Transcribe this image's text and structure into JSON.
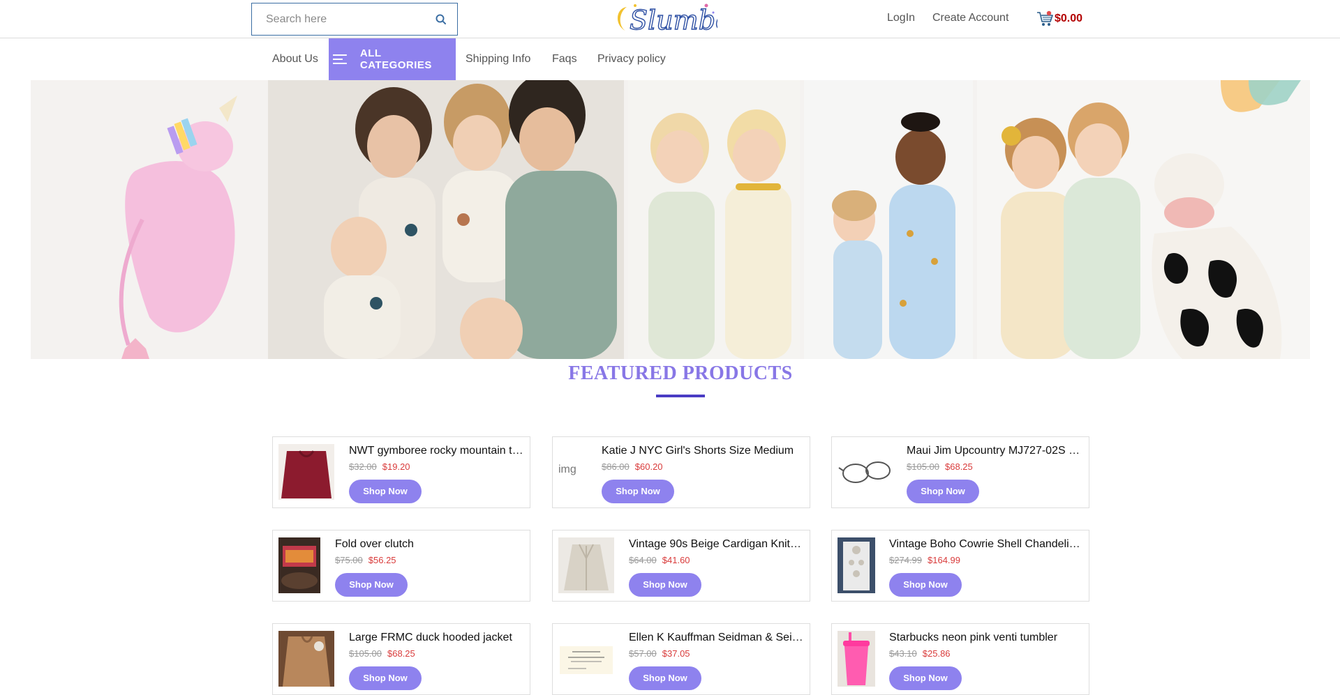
{
  "header": {
    "search_placeholder": "Search here",
    "login_label": "LogIn",
    "create_account_label": "Create Account",
    "cart_total": "$0.00"
  },
  "nav": {
    "about": "About Us",
    "all_categories": "ALL CATEGORIES",
    "shipping": "Shipping Info",
    "faqs": "Faqs",
    "privacy": "Privacy policy"
  },
  "featured": {
    "title": "FEATURED PRODUCTS",
    "shop_now_label": "Shop Now",
    "products": [
      {
        "name": "NWT gymboree rocky mountain t…",
        "old_price": "$32.00",
        "new_price": "$19.20",
        "image": "red-garment-thumb"
      },
      {
        "name": "Katie J NYC Girl's Shorts Size Medium",
        "old_price": "$86.00",
        "new_price": "$60.20",
        "image": "broken-image",
        "alt": "img"
      },
      {
        "name": "Maui Jim Upcountry MJ727-02S …",
        "old_price": "$105.00",
        "new_price": "$68.25",
        "image": "sunglasses-thumb"
      },
      {
        "name": "Fold over clutch",
        "old_price": "$75.00",
        "new_price": "$56.25",
        "image": "clutch-thumb"
      },
      {
        "name": "Vintage 90s Beige Cardigan Knit…",
        "old_price": "$64.00",
        "new_price": "$41.60",
        "image": "cardigan-thumb"
      },
      {
        "name": "Vintage Boho Cowrie Shell Chandeli…",
        "old_price": "$274.99",
        "new_price": "$164.99",
        "image": "chandelier-thumb"
      },
      {
        "name": "Large FRMC duck hooded jacket",
        "old_price": "$105.00",
        "new_price": "$68.25",
        "image": "jacket-thumb"
      },
      {
        "name": "Ellen K Kauffman Seidman & Sei…",
        "old_price": "$57.00",
        "new_price": "$37.05",
        "image": "document-thumb"
      },
      {
        "name": "Starbucks neon pink venti tumbler",
        "old_price": "$43.10",
        "new_price": "$25.86",
        "image": "tumbler-thumb"
      }
    ]
  },
  "colors": {
    "accent": "#8e82ee",
    "title_purple": "#8877e6",
    "underline": "#4a3cc4",
    "price_red": "#d93b3b",
    "cart_red": "#b30000"
  }
}
